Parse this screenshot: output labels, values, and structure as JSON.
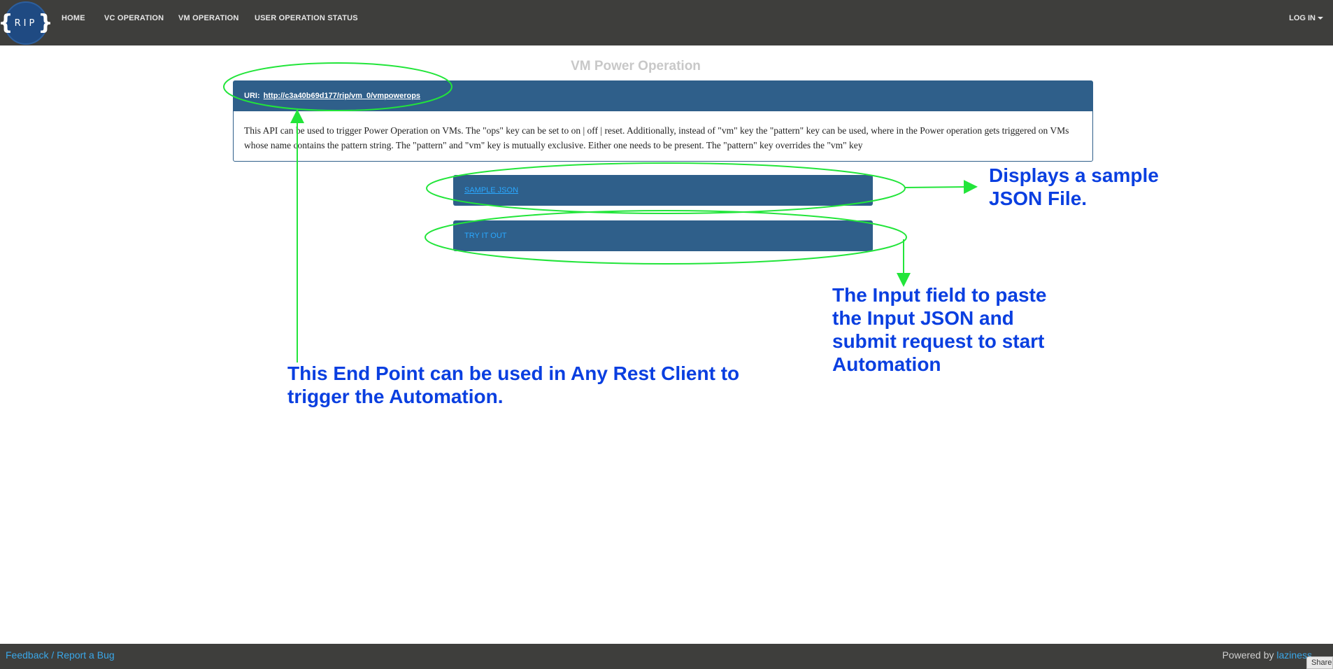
{
  "navbar": {
    "logo_text": "RIP",
    "items": [
      {
        "label": "HOME"
      },
      {
        "label": "VC OPERATION"
      },
      {
        "label": "VM OPERATION"
      },
      {
        "label": "USER OPERATION STATUS"
      }
    ],
    "login_label": "LOG IN"
  },
  "page": {
    "title": "VM Power Operation"
  },
  "api": {
    "uri_label": "URI:",
    "uri": "http://c3a40b69d177/rip/vm_0/vmpowerops",
    "description": "This API can be used to trigger Power Operation on VMs. The \"ops\" key can be set to on | off | reset. Additionally, instead of \"vm\" key the \"pattern\" key can be used, where in the Power operation gets triggered on VMs whose name contains the pattern string. The \"pattern\" and \"vm\" key is mutually exclusive. Either one needs to be present. The \"pattern\" key overrides the \"vm\" key"
  },
  "panels": {
    "sample_json": "SAMPLE JSON",
    "try_it_out": "TRY IT OUT"
  },
  "annotations": {
    "sample": "Displays a sample JSON File.",
    "input": "The Input field to paste the Input JSON and submit request to start Automation",
    "endpoint": "This End Point can be used in Any Rest Client to trigger the Automation."
  },
  "footer": {
    "feedback": "Feedback / Report a Bug",
    "powered_by": "Powered by",
    "powered_link": "laziness",
    "share": "Share"
  },
  "colors": {
    "navbar": "#3e3e3c",
    "panel": "#2f5f8a",
    "annotation_text": "#0a3fe0",
    "annotation_line": "#22e53a",
    "link": "#3aa7e8"
  }
}
